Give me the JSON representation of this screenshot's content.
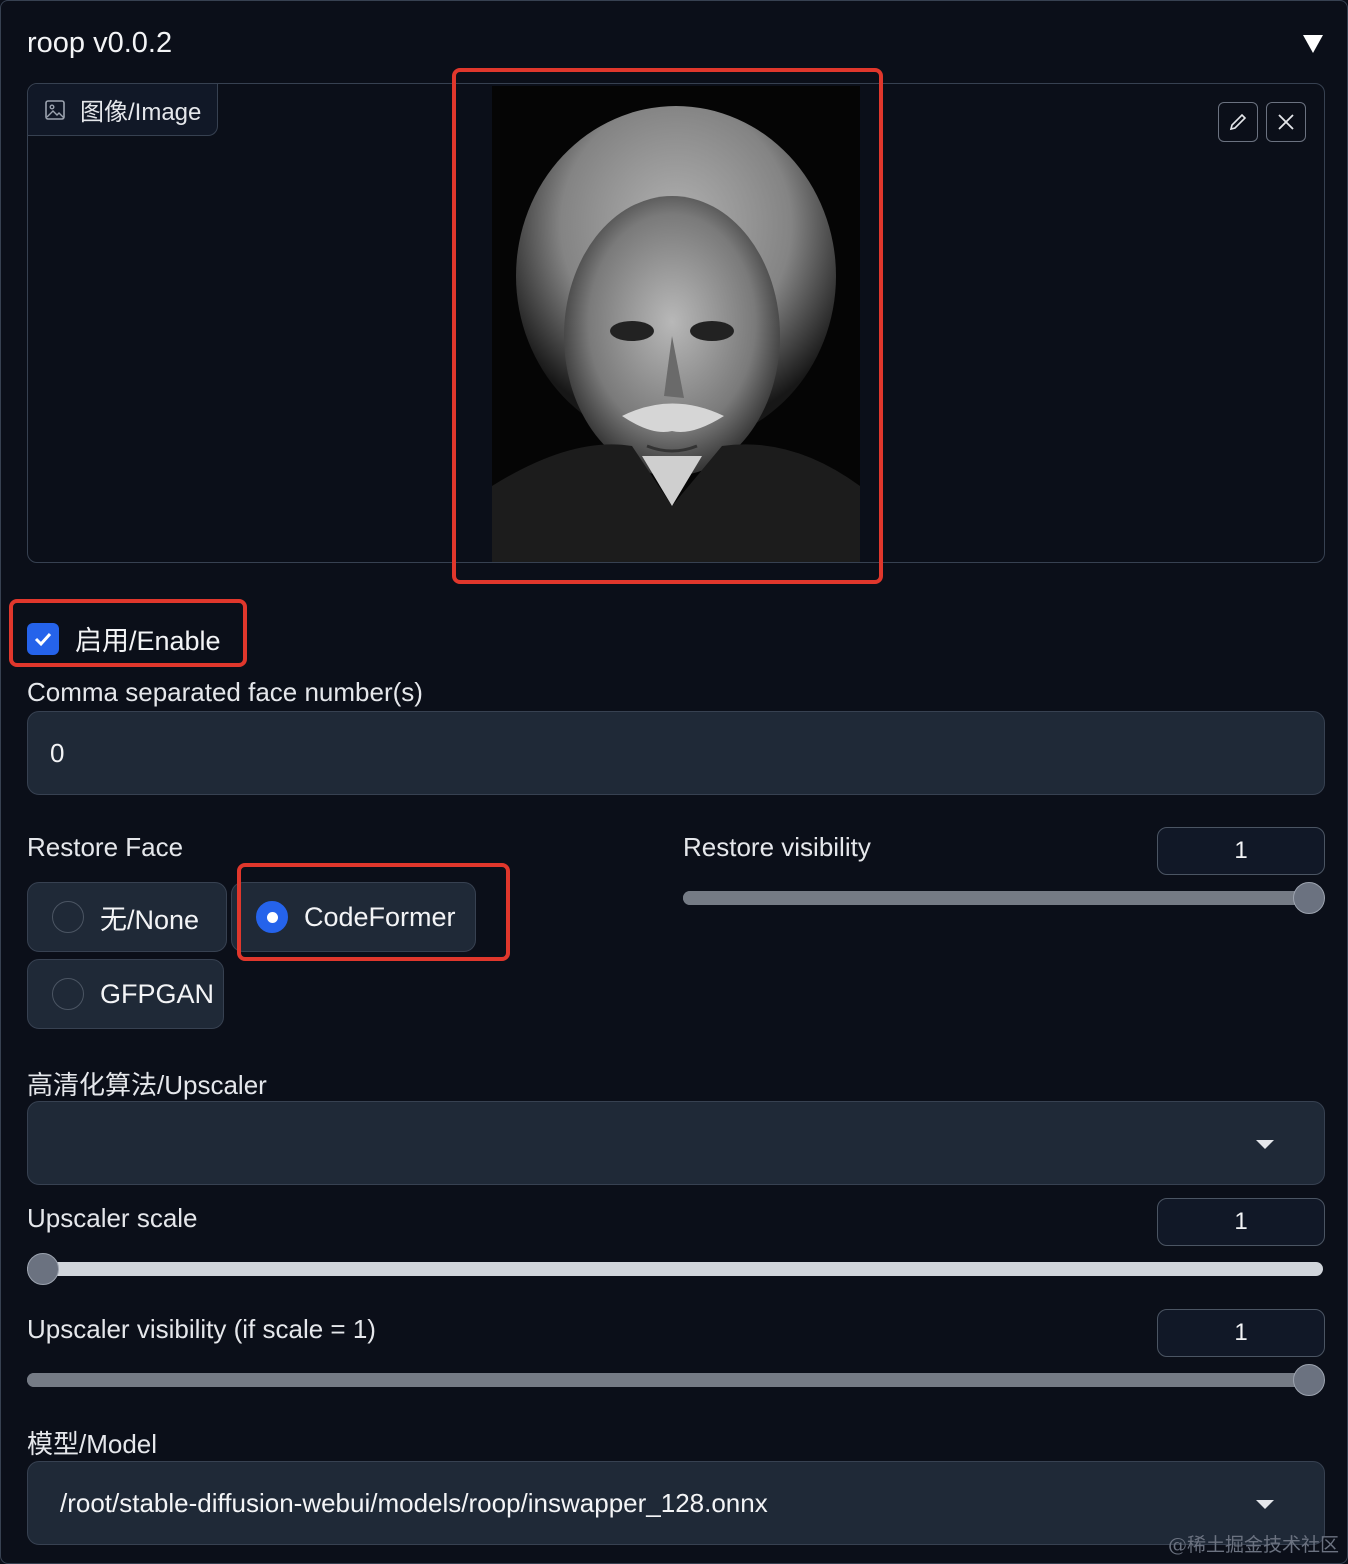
{
  "panel": {
    "title": "roop v0.0.2"
  },
  "image": {
    "label": "图像/Image"
  },
  "enable": {
    "label": "启用/Enable",
    "checked": true
  },
  "faces": {
    "label": "Comma separated face number(s)",
    "value": "0"
  },
  "restore_face": {
    "label": "Restore Face",
    "options": [
      "无/None",
      "CodeFormer",
      "GFPGAN"
    ],
    "selected": "CodeFormer"
  },
  "restore_visibility": {
    "label": "Restore visibility",
    "value": "1"
  },
  "upscaler": {
    "label": "高清化算法/Upscaler",
    "value": ""
  },
  "upscaler_scale": {
    "label": "Upscaler scale",
    "value": "1"
  },
  "upscaler_visibility": {
    "label": "Upscaler visibility (if scale = 1)",
    "value": "1"
  },
  "model": {
    "label": "模型/Model",
    "value": "/root/stable-diffusion-webui/models/roop/inswapper_128.onnx"
  },
  "watermark": "@稀土掘金技术社区",
  "colors": {
    "background": "#0b0f19",
    "accent": "#2563eb",
    "highlight": "#e0372c"
  },
  "icons": [
    "image-icon",
    "pencil-icon",
    "close-icon",
    "collapse-triangle-icon",
    "checkmark-icon",
    "chevron-down-icon"
  ]
}
